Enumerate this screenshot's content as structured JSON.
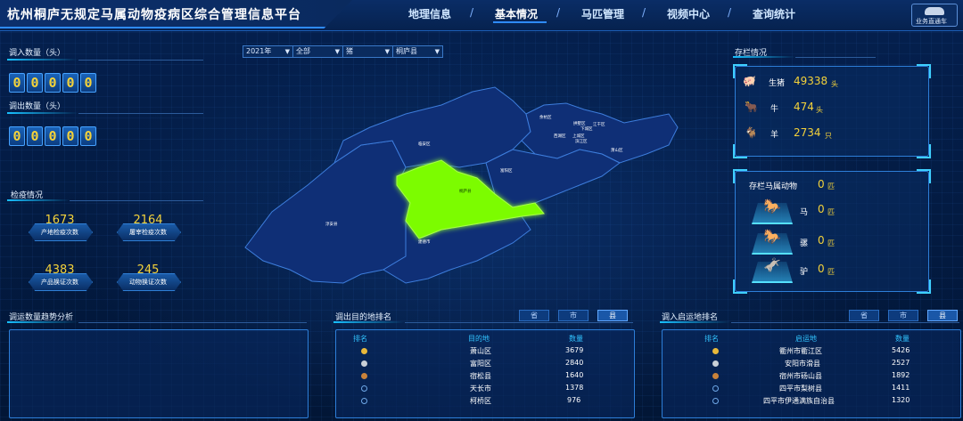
{
  "header": {
    "title": "杭州桐庐无规定马属动物疫病区综合管理信息平台",
    "nav": [
      "地理信息",
      "基本情况",
      "马匹管理",
      "视频中心",
      "查询统计"
    ],
    "active_nav": "基本情况",
    "right_button": "业务直通车"
  },
  "left": {
    "in_title": "调入数量（头）",
    "in_digits": [
      "0",
      "0",
      "0",
      "0",
      "0"
    ],
    "out_title": "调出数量（头）",
    "out_digits": [
      "0",
      "0",
      "0",
      "0",
      "0"
    ],
    "quarantine_title": "检疫情况",
    "stats": [
      {
        "value": "1673",
        "label": "产地检疫次数"
      },
      {
        "value": "2164",
        "label": "屠宰检疫次数"
      },
      {
        "value": "4383",
        "label": "产品换证次数"
      },
      {
        "value": "245",
        "label": "动物换证次数"
      }
    ]
  },
  "filters": [
    {
      "value": "2021年"
    },
    {
      "value": "全部"
    },
    {
      "value": "猪"
    },
    {
      "value": "桐庐县"
    }
  ],
  "map": {
    "district_labels": [
      "萧山区",
      "余杭区",
      "临安区",
      "滨江区",
      "上城区",
      "西湖区",
      "拱墅区",
      "江干区",
      "下城区",
      "富阳区",
      "桐庐县",
      "淳安县",
      "建德市"
    ],
    "highlight": "桐庐县",
    "highlight_color": "#7CFC00"
  },
  "stock": {
    "title": "存栏情况",
    "items": [
      {
        "icon": "pig-icon",
        "label": "生猪",
        "value": "49338",
        "unit": "头"
      },
      {
        "icon": "cow-icon",
        "label": "牛",
        "value": "474",
        "unit": "头"
      },
      {
        "icon": "sheep-icon",
        "label": "羊",
        "value": "2734",
        "unit": "只"
      }
    ]
  },
  "equine": {
    "title": "存栏马属动物",
    "total": "0",
    "total_unit": "匹",
    "items": [
      {
        "icon": "horse-icon",
        "label": "马",
        "value": "0",
        "unit": "匹"
      },
      {
        "icon": "mule-icon",
        "label": "骡",
        "value": "0",
        "unit": "匹"
      },
      {
        "icon": "donkey-icon",
        "label": "驴",
        "value": "0",
        "unit": "匹"
      }
    ]
  },
  "bottom": {
    "trend_title": "调运数量趋势分析",
    "dest_title": "调出目的地排名",
    "origin_title": "调入启运地排名",
    "tabs": [
      "省",
      "市",
      "县"
    ],
    "dest_table": {
      "headers": [
        "排名",
        "目的地",
        "数量"
      ],
      "rows": [
        {
          "name": "萧山区",
          "count": "3679"
        },
        {
          "name": "富阳区",
          "count": "2840"
        },
        {
          "name": "宿松县",
          "count": "1640"
        },
        {
          "name": "天长市",
          "count": "1378"
        },
        {
          "name": "柯桥区",
          "count": "976"
        }
      ]
    },
    "origin_table": {
      "headers": [
        "排名",
        "启运地",
        "数量"
      ],
      "rows": [
        {
          "name": "衢州市衢江区",
          "count": "5426"
        },
        {
          "name": "安阳市滑县",
          "count": "2527"
        },
        {
          "name": "宿州市砀山县",
          "count": "1892"
        },
        {
          "name": "四平市梨树县",
          "count": "1411"
        },
        {
          "name": "四平市伊通满族自治县",
          "count": "1320"
        }
      ]
    }
  },
  "colors": {
    "accent": "#18c0ff",
    "number": "#f4d23a",
    "gold": "#e8b83a",
    "silver": "#c9d0d8",
    "bronze": "#c9823a"
  }
}
